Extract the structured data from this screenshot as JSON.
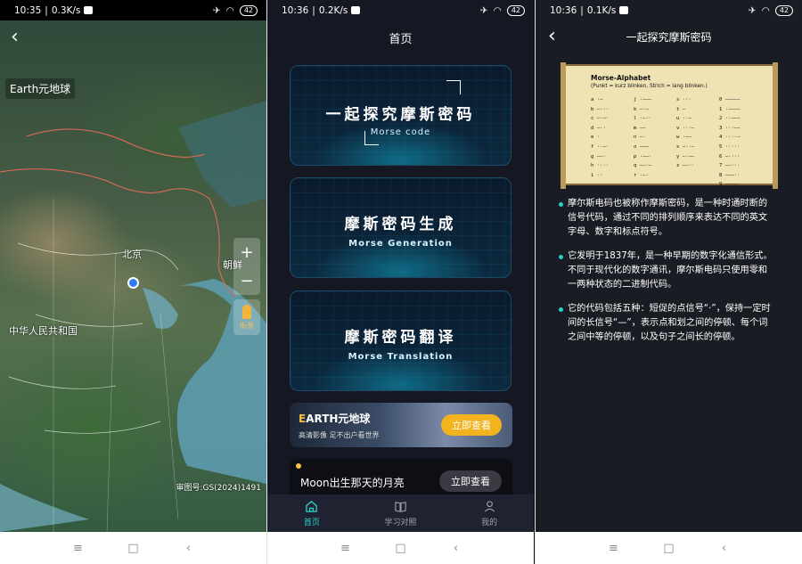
{
  "status": [
    {
      "time": "10:35",
      "net": "0.3K/s",
      "battery": "42"
    },
    {
      "time": "10:36",
      "net": "0.2K/s",
      "battery": "42"
    },
    {
      "time": "10:36",
      "net": "0.1K/s",
      "battery": "42"
    }
  ],
  "navbar": {
    "menu": "≡",
    "home": "□",
    "back": "‹"
  },
  "map_screen": {
    "title": "Earth元地球",
    "labels": {
      "beijing": "北京",
      "china": "中华人民共和国",
      "korea": "朝鲜"
    },
    "zoom_in": "+",
    "zoom_out": "−",
    "street_view": "街景",
    "copyright": "审图号:GS(2024)1491",
    "back": "‹"
  },
  "home_screen": {
    "title": "首页",
    "cards": [
      {
        "cn": "一起探究摩斯密码",
        "en": "Morse code"
      },
      {
        "cn": "摩斯密码生成",
        "en": "Morse Generation"
      },
      {
        "cn": "摩斯密码翻译",
        "en": "Morse Translation"
      }
    ],
    "banner": {
      "title_e": "E",
      "title_rest": "ARTH元地球",
      "subtitle": "高清影像 足不出户看世界",
      "button": "立即查看"
    },
    "moon": {
      "title": "Moon出生那天的月亮",
      "button": "立即查看"
    },
    "tabs": [
      {
        "label": "首页",
        "icon": "home-icon"
      },
      {
        "label": "学习对照",
        "icon": "book-icon"
      },
      {
        "label": "我的",
        "icon": "user-icon"
      }
    ]
  },
  "article_screen": {
    "title": "一起探究摩斯密码",
    "back": "‹",
    "image": {
      "title": "Morse-Alphabet",
      "subtitle": "(Punkt = kurz blinken, Strich = lang blinken.)",
      "col1": [
        "a ·–",
        "b –···",
        "c –·–·",
        "d –··",
        "e ·",
        "f ··–·",
        "g ––·",
        "h ····",
        "i ··"
      ],
      "col2": [
        "j ·–––",
        "k –·–",
        "l ·–··",
        "m ––",
        "n –·",
        "o –––",
        "p ·––·",
        "q ––·–",
        "r ·–·"
      ],
      "col3": [
        "s ···",
        "t –",
        "u ··–",
        "v ···–",
        "w ·––",
        "x –··–",
        "y –·––",
        "z ––··",
        ""
      ],
      "col4": [
        "0 –––––",
        "1 ·––––",
        "2 ··–––",
        "3 ···––",
        "4 ····–",
        "5 ·····",
        "6 –····",
        "7 ––···",
        "8 –––··",
        "9 ––––·"
      ]
    },
    "paragraphs": [
      "摩尔斯电码也被称作摩斯密码，是一种时通时断的信号代码，通过不同的排列顺序来表达不同的英文字母、数字和标点符号。",
      "它发明于1837年，是一种早期的数字化通信形式。不同于现代化的数字通讯，摩尔斯电码只使用零和一两种状态的二进制代码。",
      "它的代码包括五种：短促的点信号“·”，保持一定时间的长信号“—”，表示点和划之间的停顿、每个词之间中等的停顿，以及句子之间长的停顿。"
    ]
  }
}
